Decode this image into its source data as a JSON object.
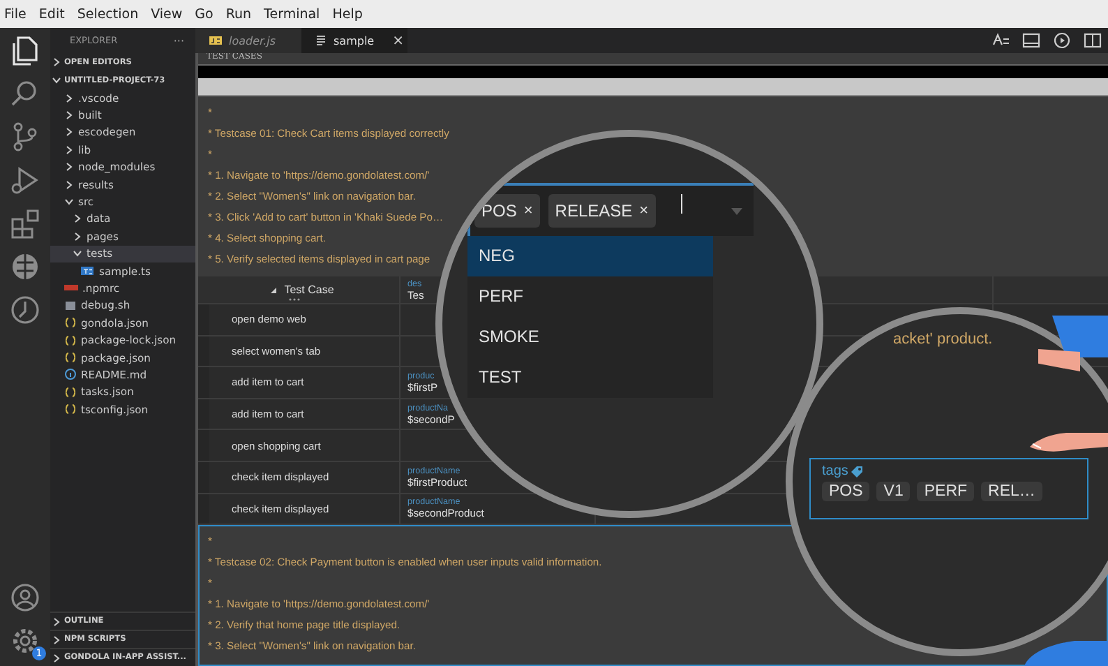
{
  "menu": [
    "File",
    "Edit",
    "Selection",
    "View",
    "Go",
    "Run",
    "Terminal",
    "Help"
  ],
  "activity_bar": [
    {
      "kind": "files",
      "selected": true
    },
    {
      "kind": "search",
      "selected": false
    },
    {
      "kind": "source-control",
      "selected": false
    },
    {
      "kind": "run",
      "selected": false
    },
    {
      "kind": "extensions",
      "selected": false
    },
    {
      "kind": "globe",
      "selected": false
    },
    {
      "kind": "timeline",
      "selected": false
    }
  ],
  "activity_bottom": [
    {
      "kind": "account"
    },
    {
      "kind": "settings",
      "badge": "1"
    }
  ],
  "sidebar": {
    "title": "EXPLORER",
    "more": "···",
    "sections": [
      {
        "label": "OPEN EDITORS",
        "expanded": false
      },
      {
        "label": "UNTITLED-PROJECT-73",
        "expanded": true,
        "children": [
          {
            "label": ".vscode",
            "kind": "folder",
            "expanded": false,
            "selected": false
          },
          {
            "label": "built",
            "kind": "folder",
            "expanded": false,
            "selected": false
          },
          {
            "label": "escodegen",
            "kind": "folder",
            "expanded": false,
            "selected": false
          },
          {
            "label": "lib",
            "kind": "folder",
            "expanded": false,
            "selected": false
          },
          {
            "label": "node_modules",
            "kind": "folder",
            "expanded": false,
            "selected": false
          },
          {
            "label": "results",
            "kind": "folder",
            "expanded": false,
            "selected": false
          },
          {
            "label": "src",
            "kind": "folder",
            "expanded": true,
            "selected": false,
            "children": [
              {
                "label": "data",
                "kind": "folder",
                "expanded": false,
                "selected": false
              },
              {
                "label": "pages",
                "kind": "folder",
                "expanded": false,
                "selected": false
              },
              {
                "label": "tests",
                "kind": "folder",
                "expanded": true,
                "selected": true,
                "children": [
                  {
                    "label": "sample.ts",
                    "kind": "ts",
                    "selected": false
                  }
                ]
              }
            ]
          },
          {
            "label": ".npmrc",
            "kind": "npm",
            "selected": false
          },
          {
            "label": "debug.sh",
            "kind": "shell",
            "selected": false
          },
          {
            "label": "gondola.json",
            "kind": "json",
            "selected": false
          },
          {
            "label": "package-lock.json",
            "kind": "json",
            "selected": false
          },
          {
            "label": "package.json",
            "kind": "json",
            "selected": false
          },
          {
            "label": "README.md",
            "kind": "info",
            "selected": false
          },
          {
            "label": "tasks.json",
            "kind": "json",
            "selected": false
          },
          {
            "label": "tsconfig.json",
            "kind": "json",
            "selected": false
          }
        ]
      }
    ],
    "bottom_sections": [
      {
        "label": "OUTLINE",
        "expanded": false
      },
      {
        "label": "NPM SCRIPTS",
        "expanded": false
      },
      {
        "label": "GONDOLA IN-APP ASSIST...",
        "expanded": false
      }
    ]
  },
  "tabs": [
    {
      "label": "loader.js",
      "kind": "js",
      "selected": false
    },
    {
      "label": "sample",
      "kind": "doc",
      "selected": true,
      "close": "×"
    }
  ],
  "editor_actions": [
    {
      "kind": "compare"
    },
    {
      "kind": "panel"
    },
    {
      "kind": "run"
    },
    {
      "kind": "split"
    }
  ],
  "editor": {
    "caption": "TEST CASES",
    "block_1": {
      "selected": false,
      "lines": [
        "*",
        "* Testcase 01: Check Cart items displayed correctly",
        "*",
        "* 1. Navigate to 'https://demo.gondolatest.com/'",
        "* 2. Select \"Women's\" link on navigation bar.",
        "* 3. Click 'Add to cart' button in 'Khaki Suede Po…",
        "* 4. Select shopping cart.",
        "* 5. Verify selected items displayed in cart page"
      ]
    },
    "table": {
      "columns": [
        {
          "label": "Test Case"
        },
        {
          "label": "des",
          "value": "Tes"
        }
      ],
      "rows": [
        {
          "step": "open demo web"
        },
        {
          "step": "select women's tab"
        },
        {
          "step": "add item to cart",
          "param_name": "produc",
          "param_value": "$firstP"
        },
        {
          "step": "add item to cart",
          "param_name": "productNa",
          "param_value": "$secondP"
        },
        {
          "step": "open shopping cart"
        },
        {
          "step": "check item displayed",
          "param_name": "productName",
          "param_value": "$firstProduct"
        },
        {
          "step": "check item displayed",
          "param_name": "productName",
          "param_value": "$secondProduct"
        }
      ]
    },
    "block_2": {
      "selected": true,
      "lines": [
        "*",
        "* Testcase 02: Check Payment button is enabled when user inputs valid information.",
        "*",
        "* 1. Navigate to 'https://demo.gondolatest.com/'",
        "* 2. Verify that home page title displayed.",
        "* 3. Select \"Women's\" link on navigation bar."
      ]
    }
  },
  "magnifiers": [
    {
      "kind": "tag-select",
      "chips": [
        {
          "label": "POS",
          "remove": "×"
        },
        {
          "label": "RELEASE",
          "remove": "×"
        }
      ],
      "options": [
        {
          "label": "NEG",
          "selected": true
        },
        {
          "label": "PERF",
          "selected": false
        },
        {
          "label": "SMOKE",
          "selected": false
        },
        {
          "label": "TEST",
          "selected": false
        }
      ]
    },
    {
      "kind": "tags-view",
      "text": "acket' product.",
      "label": "tags",
      "tags": [
        "POS",
        "V1",
        "PERF",
        "REL…"
      ]
    }
  ]
}
